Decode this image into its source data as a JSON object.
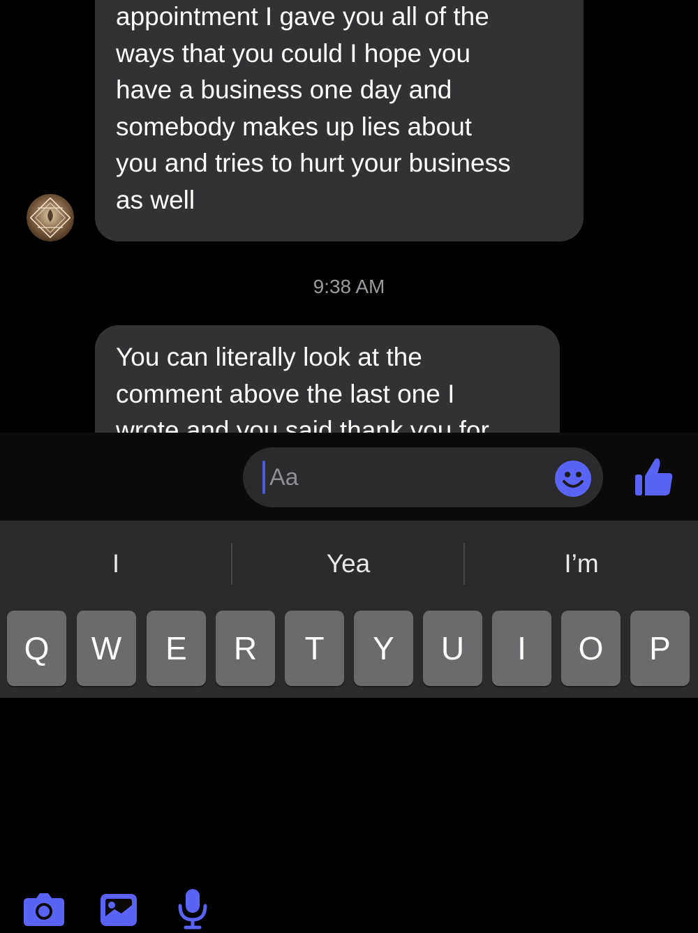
{
  "messages": [
    {
      "text": "appointment I gave you all of the\nways that you could I hope you\nhave a business one day and\nsomebody makes up lies about\nyou and tries to hurt your business\nas well"
    },
    {
      "text": "You can literally look at the\ncomment above the last one I\nwrote and you said thank you for"
    }
  ],
  "timestamp": "9:38 AM",
  "composer": {
    "placeholder": "Aa",
    "accent_color": "#5b63f5"
  },
  "icons": {
    "camera": "camera-icon",
    "gallery": "image-icon",
    "mic": "microphone-icon",
    "emoji": "emoji-icon",
    "like": "thumbs-up-icon"
  },
  "suggestions": [
    "I",
    "Yea",
    "I’m"
  ],
  "keyboard": {
    "row1": [
      "Q",
      "W",
      "E",
      "R",
      "T",
      "Y",
      "U",
      "I",
      "O",
      "P"
    ]
  }
}
